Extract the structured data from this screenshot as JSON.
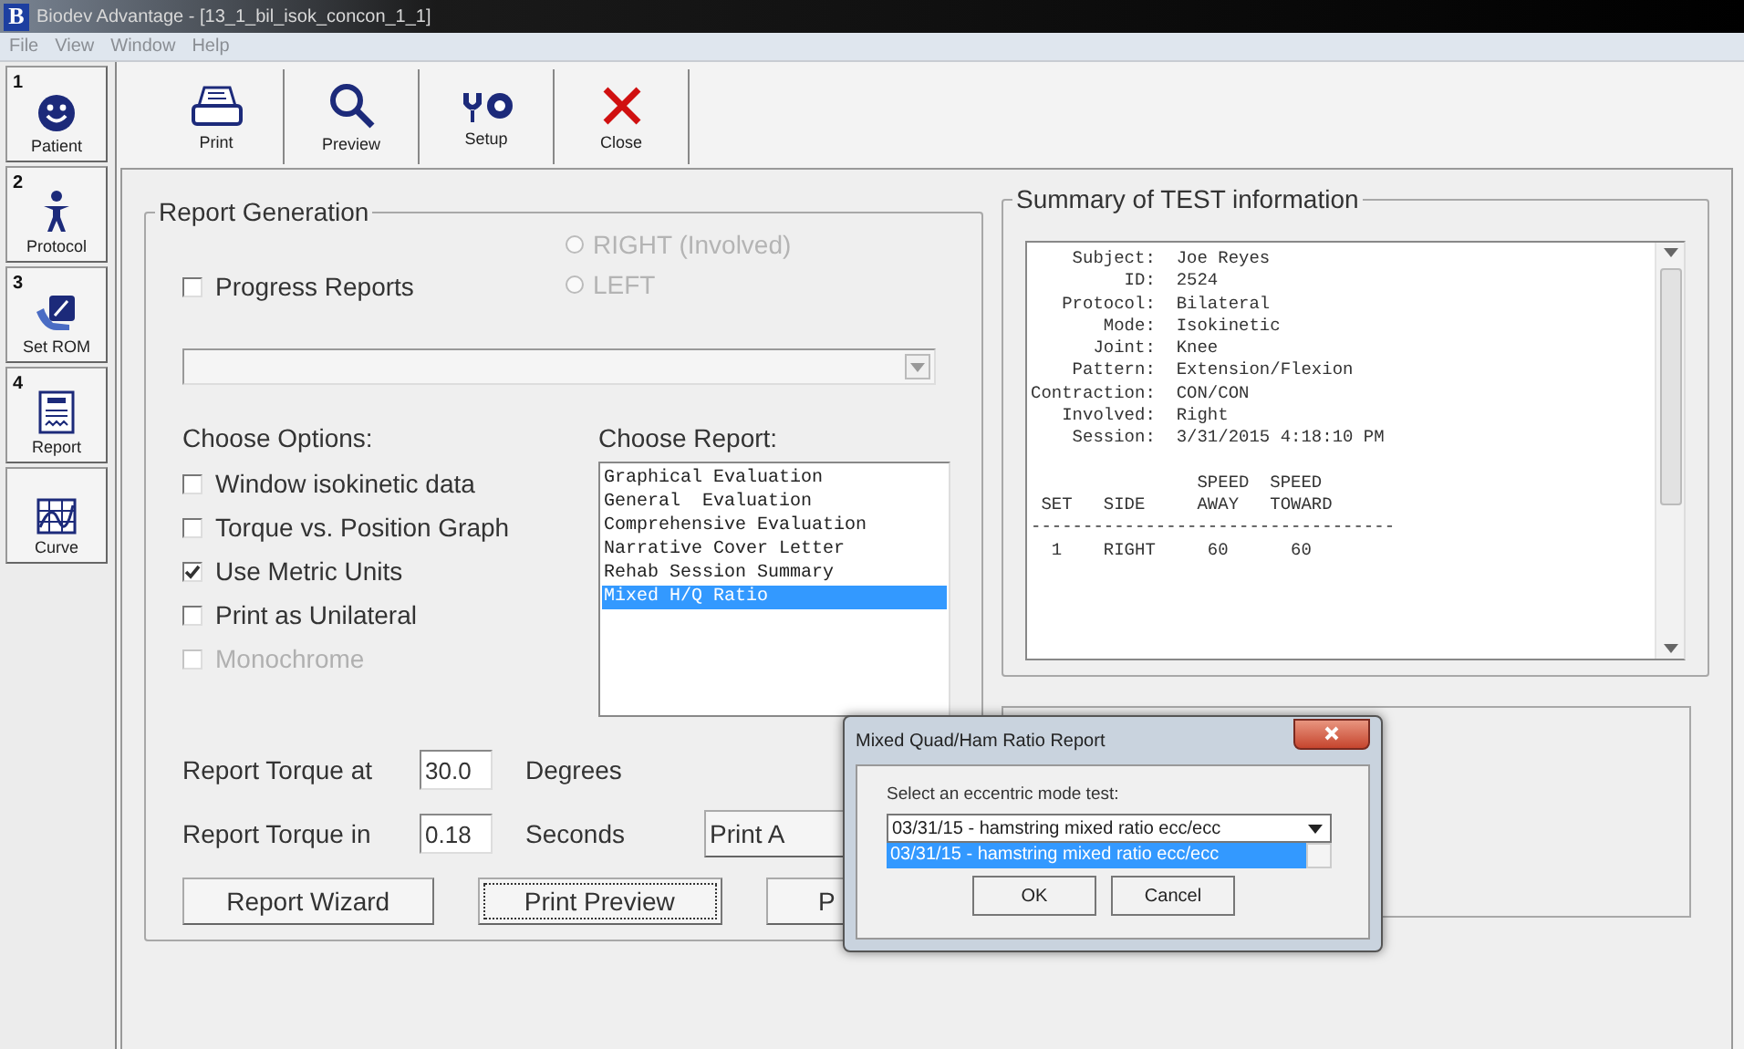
{
  "window": {
    "app_letter": "B",
    "title": "Biodev Advantage - [13_1_bil_isok_concon_1_1]"
  },
  "menu": [
    "File",
    "View",
    "Window",
    "Help"
  ],
  "sidebar": [
    {
      "number": "1",
      "label": "Patient",
      "kind": "patient"
    },
    {
      "number": "2",
      "label": "Protocol",
      "kind": "protocol"
    },
    {
      "number": "3",
      "label": "Set ROM",
      "kind": "rom"
    },
    {
      "number": "4",
      "label": "Report",
      "kind": "report"
    },
    {
      "label": "Curve",
      "kind": "curve"
    }
  ],
  "toolbar": [
    {
      "label": "Print",
      "kind": "print"
    },
    {
      "label": "Preview",
      "kind": "preview"
    },
    {
      "label": "Setup",
      "kind": "setup"
    },
    {
      "label": "Close",
      "kind": "close"
    }
  ],
  "report_generation": {
    "title": "Report Generation",
    "progress_reports": {
      "label": "Progress Reports",
      "checked": false
    },
    "sides": [
      {
        "label": "RIGHT (Involved)",
        "selected": false,
        "disabled": true
      },
      {
        "label": "LEFT",
        "selected": false,
        "disabled": true
      }
    ],
    "options_heading": "Choose Options:",
    "options": [
      {
        "label": "Window isokinetic data",
        "checked": false,
        "disabled": false
      },
      {
        "label": "Torque vs. Position Graph",
        "checked": false,
        "disabled": false
      },
      {
        "label": "Use Metric Units",
        "checked": true,
        "disabled": false
      },
      {
        "label": "Print as Unilateral",
        "checked": false,
        "disabled": false
      },
      {
        "label": "Monochrome",
        "checked": false,
        "disabled": true
      }
    ],
    "report_heading": "Choose Report:",
    "reports": [
      {
        "label": "Graphical Evaluation",
        "selected": false
      },
      {
        "label": "General  Evaluation",
        "selected": false
      },
      {
        "label": "Comprehensive Evaluation",
        "selected": false
      },
      {
        "label": "Narrative Cover Letter",
        "selected": false
      },
      {
        "label": "Rehab Session Summary",
        "selected": false
      },
      {
        "label": "Mixed H/Q Ratio",
        "selected": true
      }
    ],
    "torque_at": {
      "label": "Report Torque at",
      "value": "30.0",
      "unit": "Degrees"
    },
    "torque_in": {
      "label": "Report Torque in",
      "value": "0.18",
      "unit": "Seconds"
    },
    "side_button": {
      "label": "Print A"
    },
    "buttons": [
      {
        "label": "Report Wizard",
        "focused": false
      },
      {
        "label": "Print Preview",
        "focused": true
      },
      {
        "label": "P",
        "focused": false
      }
    ]
  },
  "summary": {
    "title": "Summary of TEST information",
    "info_lines": [
      "    Subject:  Joe Reyes",
      "         ID:  2524",
      "   Protocol:  Bilateral",
      "       Mode:  Isokinetic",
      "      Joint:  Knee",
      "    Pattern:  Extension/Flexion",
      "Contraction:  CON/CON",
      "   Involved:  Right",
      "    Session:  3/31/2015 4:18:10 PM"
    ],
    "table_lines": [
      "                SPEED  SPEED",
      " SET   SIDE     AWAY   TOWARD",
      "-----------------------------------",
      "  1    RIGHT     60      60"
    ]
  },
  "dialog": {
    "title": "Mixed Quad/Ham Ratio Report",
    "prompt": "Select an eccentric mode test:",
    "value": "03/31/15 - hamstring mixed ratio ecc/ecc",
    "options": [
      {
        "label": "03/31/15 - hamstring mixed ratio ecc/ecc",
        "selected": true
      }
    ],
    "buttons": [
      "OK",
      "Cancel"
    ]
  }
}
